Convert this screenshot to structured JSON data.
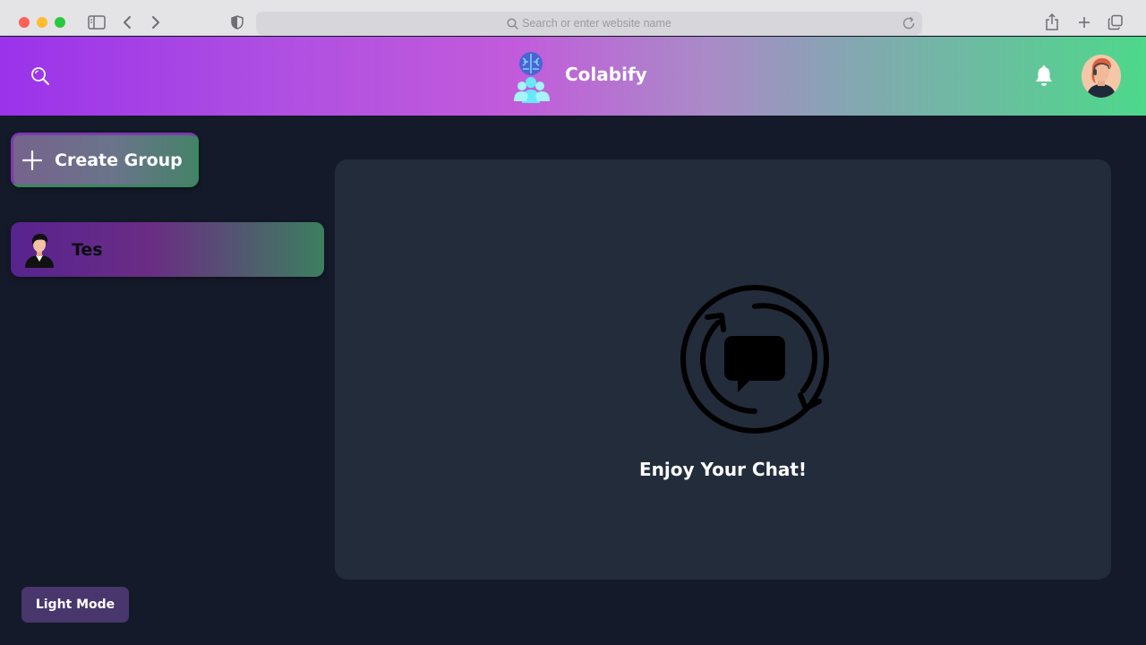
{
  "browser": {
    "url_placeholder": "Search or enter website name"
  },
  "header": {
    "app_title": "Colabify",
    "accent_gradient": [
      "#9a33ea",
      "#c25bdb",
      "#82a8b0",
      "#4dd88a"
    ]
  },
  "sidebar": {
    "create_group_label": "Create Group",
    "groups": [
      {
        "name": "Tes",
        "avatar_icon": "person-avatar-icon"
      }
    ],
    "mode_toggle_label": "Light Mode"
  },
  "chat": {
    "empty_message": "Enjoy Your Chat!",
    "empty_icon": "chat-sync-icon"
  },
  "colors": {
    "background": "#141a29",
    "panel": "#232c3b",
    "mode_button": "#48366d"
  }
}
